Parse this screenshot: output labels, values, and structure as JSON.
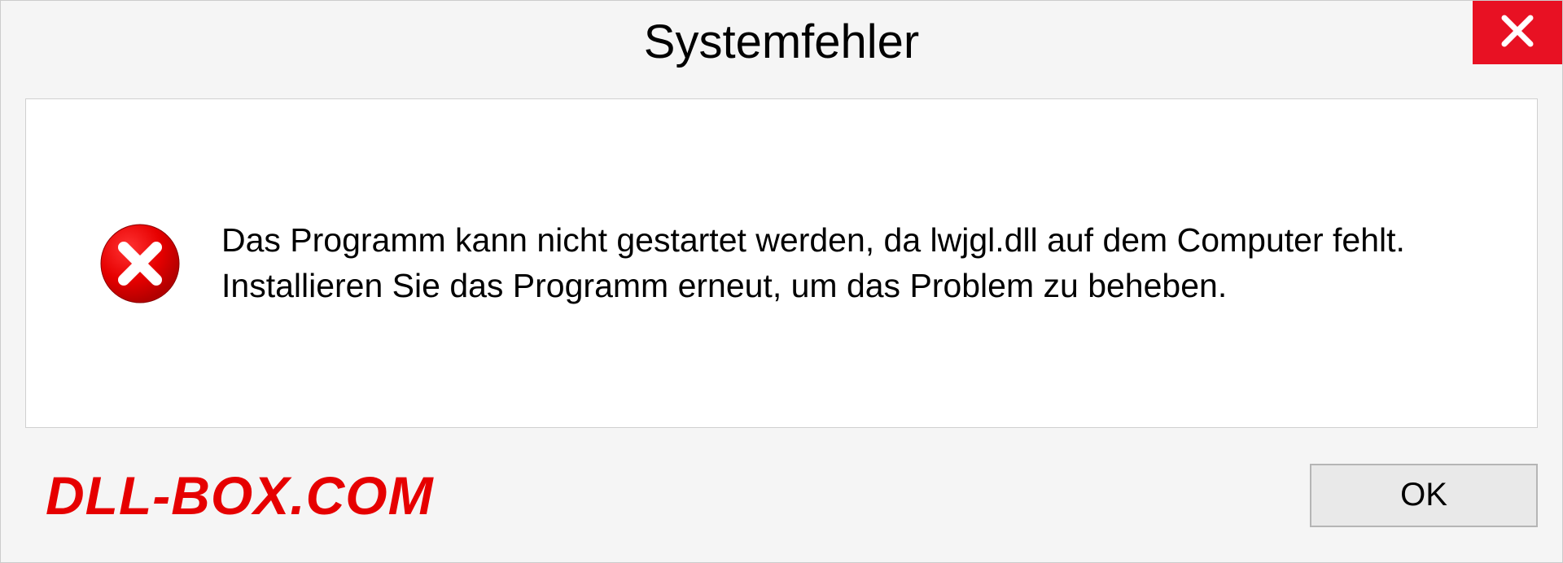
{
  "dialog": {
    "title": "Systemfehler",
    "message": "Das Programm kann nicht gestartet werden, da lwjgl.dll auf dem Computer fehlt. Installieren Sie das Programm erneut, um das Problem zu beheben.",
    "ok_label": "OK"
  },
  "watermark": {
    "text": "DLL-BOX.COM"
  },
  "colors": {
    "close_button": "#e81123",
    "error_icon": "#e60000",
    "watermark": "#e60000"
  }
}
